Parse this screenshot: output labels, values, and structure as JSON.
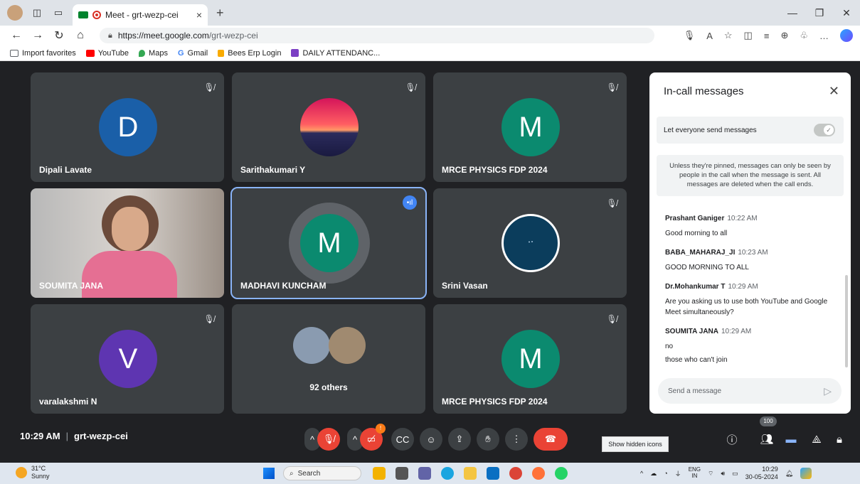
{
  "browser": {
    "tab_title": "Meet - grt-wezp-cei",
    "tab_close": "×",
    "new_tab": "+",
    "url_host": "https://meet.google.com",
    "url_path": "/grt-wezp-cei",
    "bookmarks": [
      {
        "label": "Import favorites",
        "color": "#5f6368"
      },
      {
        "label": "YouTube",
        "color": "#ff0000"
      },
      {
        "label": "Maps",
        "color": "#34a853"
      },
      {
        "label": "Gmail",
        "color": "#4285f4"
      },
      {
        "label": "Bees Erp Login",
        "color": "#f9ab00"
      },
      {
        "label": "DAILY ATTENDANC...",
        "color": "#7b3fc4"
      }
    ]
  },
  "participants": [
    {
      "name": "Dipali Lavate",
      "initial": "D",
      "color": "#1a5fa8",
      "muted": true
    },
    {
      "name": "Sarithakumari Y",
      "initial": "",
      "color": "",
      "muted": true,
      "image": "sunset"
    },
    {
      "name": "MRCE PHYSICS FDP 2024",
      "initial": "M",
      "color": "#0b8a6f",
      "muted": true
    },
    {
      "name": "SOUMITA JANA",
      "initial": "",
      "color": "",
      "muted": false,
      "image": "video"
    },
    {
      "name": "MADHAVI KUNCHAM",
      "initial": "M",
      "color": "#0b8a6f",
      "muted": false,
      "speaking": true
    },
    {
      "name": "Srini Vasan",
      "initial": "",
      "color": "",
      "muted": true,
      "image": "quote"
    },
    {
      "name": "varalakshmi N",
      "initial": "V",
      "color": "#5e35b1",
      "muted": true
    },
    {
      "name": "",
      "others": "92 others",
      "muted": false
    },
    {
      "name": "MRCE PHYSICS FDP 2024",
      "initial": "M",
      "color": "#0b8a6f",
      "muted": true
    }
  ],
  "chat": {
    "title": "In-call messages",
    "toggle_label": "Let everyone send messages",
    "notice": "Unless they're pinned, messages can only be seen by people in the call when the message is sent. All messages are deleted when the call ends.",
    "messages": [
      {
        "sender": "Prashant Ganiger",
        "time": "10:22 AM",
        "lines": [
          "Good morning to all"
        ]
      },
      {
        "sender": "BABA_MAHARAJ_JI",
        "time": "10:23 AM",
        "lines": [
          "GOOD MORNING TO ALL"
        ]
      },
      {
        "sender": "Dr.Mohankumar T",
        "time": "10:29 AM",
        "lines": [
          "Are you asking us to use both YouTube and Google Meet simultaneously?"
        ]
      },
      {
        "sender": "SOUMITA JANA",
        "time": "10:29 AM",
        "lines": [
          "no",
          "those who can't join"
        ]
      }
    ],
    "input_placeholder": "Send a message"
  },
  "controls": {
    "time": "10:29 AM",
    "meeting_code": "grt-wezp-cei",
    "separator": "|",
    "participant_count": "100",
    "camera_badge": "!"
  },
  "tooltip": "Show hidden icons",
  "taskbar": {
    "temp": "31°C",
    "weather": "Sunny",
    "search": "Search",
    "lang1": "ENG",
    "lang2": "IN",
    "clock_time": "10:29",
    "clock_date": "30-05-2024"
  }
}
